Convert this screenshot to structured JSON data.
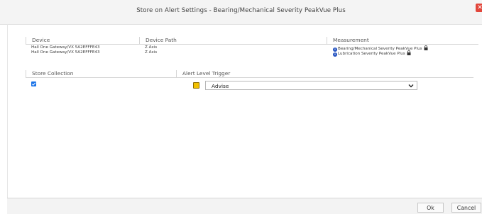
{
  "dialog": {
    "title": "Store on Alert Settings - Bearing/Mechanical Severity PeakVue Plus",
    "close_label": "✕"
  },
  "table": {
    "headers": [
      "Device",
      "Device Path",
      "Measurement"
    ],
    "rows": [
      {
        "device": "Hall One Gateway/VX 5A2EFFFE43",
        "path": "Z Axis",
        "measurement": "Bearing/Mechanical Severity PeakVue Plus"
      },
      {
        "device": "Hall One Gateway/VX 5A2EFFFE43",
        "path": "Z Axis",
        "measurement": "Lubrication Severity PeakVue Plus"
      }
    ]
  },
  "settings": {
    "headers": [
      "Store Collection",
      "Alert Level Trigger"
    ],
    "store_collection_checked": true,
    "trigger_color": "#f2c100",
    "trigger_value": "Advise"
  },
  "footer": {
    "ok_label": "Ok",
    "cancel_label": "Cancel"
  },
  "icons": {
    "info": "info-icon",
    "lock": "lock-icon",
    "chevron": "chevron-down-icon",
    "check": "check-icon"
  }
}
